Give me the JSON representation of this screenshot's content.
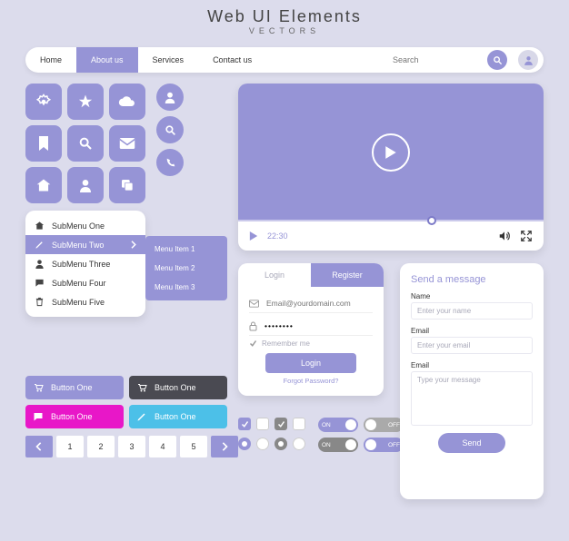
{
  "header": {
    "title": "Web UI Elements",
    "subtitle": "VECTORS"
  },
  "nav": {
    "items": [
      "Home",
      "About us",
      "Services",
      "Contact us"
    ],
    "active_index": 1,
    "search_placeholder": "Search"
  },
  "icon_grid": [
    "settings",
    "star",
    "cloud",
    "bookmark",
    "search",
    "mail",
    "home",
    "user",
    "copy"
  ],
  "round_icons": [
    "person",
    "search",
    "phone"
  ],
  "submenu": {
    "items": [
      {
        "icon": "home",
        "label": "SubMenu One"
      },
      {
        "icon": "pencil",
        "label": "SubMenu Two"
      },
      {
        "icon": "person",
        "label": "SubMenu Three"
      },
      {
        "icon": "chat",
        "label": "SubMenu Four"
      },
      {
        "icon": "trash",
        "label": "SubMenu Five"
      }
    ],
    "active_index": 1,
    "flyout": [
      "Menu Item 1",
      "Menu Item 2",
      "Menu Item 3"
    ]
  },
  "buttons": [
    {
      "icon": "cart",
      "label": "Button One",
      "style": "lav"
    },
    {
      "icon": "cart",
      "label": "Button One",
      "style": "dark"
    },
    {
      "icon": "chat",
      "label": "Button One",
      "style": "mag"
    },
    {
      "icon": "pencil",
      "label": "Button One",
      "style": "cy"
    }
  ],
  "pagination": {
    "pages": [
      "1",
      "2",
      "3",
      "4",
      "5"
    ]
  },
  "player": {
    "time": "22:30"
  },
  "login": {
    "tab_login": "Login",
    "tab_register": "Register",
    "email_placeholder": "Email@yourdomain.com",
    "password_value": "••••••••",
    "remember": "Remember me",
    "login_btn": "Login",
    "forgot": "Forgot Password?"
  },
  "toggles": {
    "on": "ON",
    "off": "OFF"
  },
  "contact": {
    "title": "Send a message",
    "name_label": "Name",
    "name_ph": "Enter your name",
    "email_label": "Email",
    "email_ph": "Enter your email",
    "msg_label": "Email",
    "msg_ph": "Type your message",
    "send": "Send"
  }
}
